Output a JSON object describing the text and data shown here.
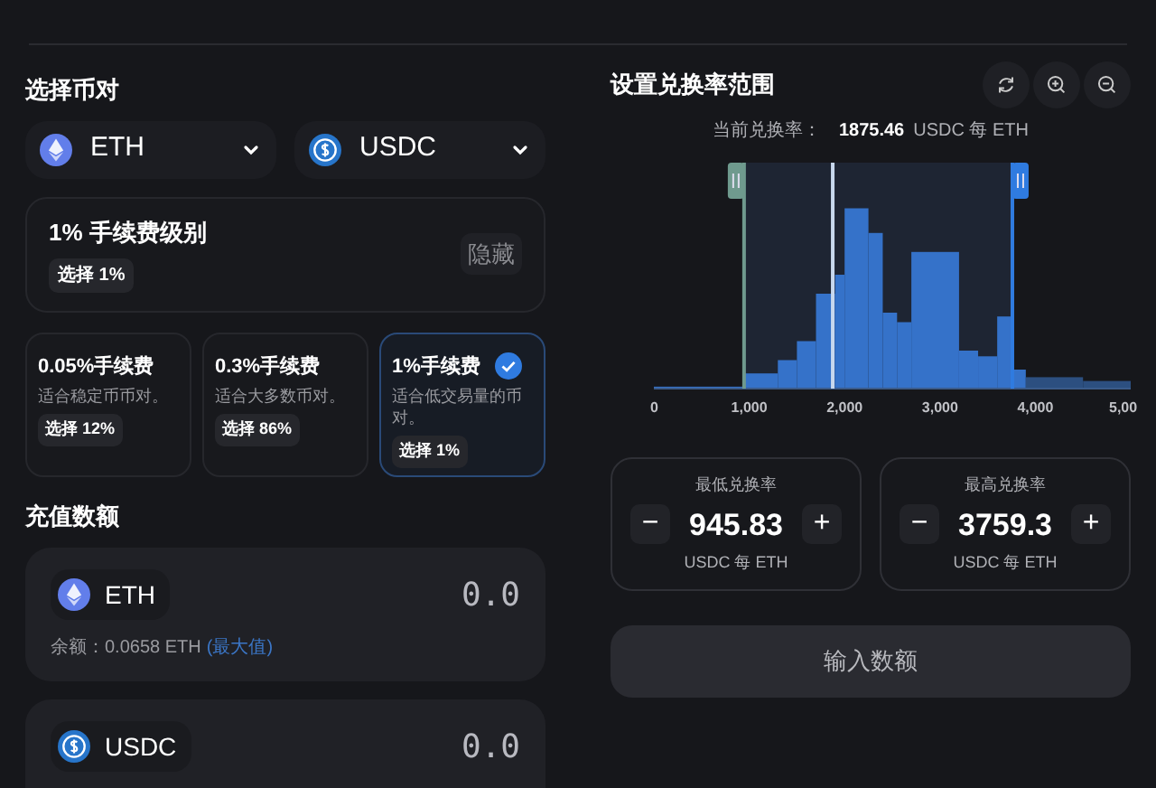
{
  "pair_section": {
    "title": "选择币对",
    "tokens": [
      {
        "symbol": "ETH",
        "kind": "eth"
      },
      {
        "symbol": "USDC",
        "kind": "usdc"
      }
    ]
  },
  "fee_tier": {
    "title": "1% 手续费级别",
    "badge": "选择 1%",
    "toggle": "隐藏"
  },
  "fee_options": [
    {
      "title": "0.05%手续费",
      "description": "适合稳定币币对。",
      "badge": "选择 12%",
      "selected": false
    },
    {
      "title": "0.3%手续费",
      "description": "适合大多数币对。",
      "badge": "选择 86%",
      "selected": false
    },
    {
      "title": "1%手续费",
      "description": "适合低交易量的币对。",
      "badge": "选择 1%",
      "selected": true
    }
  ],
  "deposit": {
    "title": "充值数额",
    "assets": [
      {
        "symbol": "ETH",
        "kind": "eth",
        "amount": "0.0",
        "balance": "余额：0.0658 ETH",
        "max": "(最大值)"
      },
      {
        "symbol": "USDC",
        "kind": "usdc",
        "amount": "0.0"
      }
    ]
  },
  "range": {
    "title": "设置兑换率范围",
    "current_label": "当前兑换率：",
    "current_value": "1875.46",
    "current_unit": "USDC 每 ETH",
    "axis_ticks": [
      "0",
      "1,000",
      "2,000",
      "3,000",
      "4,000",
      "5,00"
    ],
    "bounds": [
      {
        "label": "最低兑换率",
        "value": "945.83",
        "unit": "USDC 每 ETH",
        "minus": "−",
        "plus": "+"
      },
      {
        "label": "最高兑换率",
        "value": "3759.3",
        "unit": "USDC 每 ETH",
        "minus": "−",
        "plus": "+"
      }
    ]
  },
  "submit": "输入数额"
}
